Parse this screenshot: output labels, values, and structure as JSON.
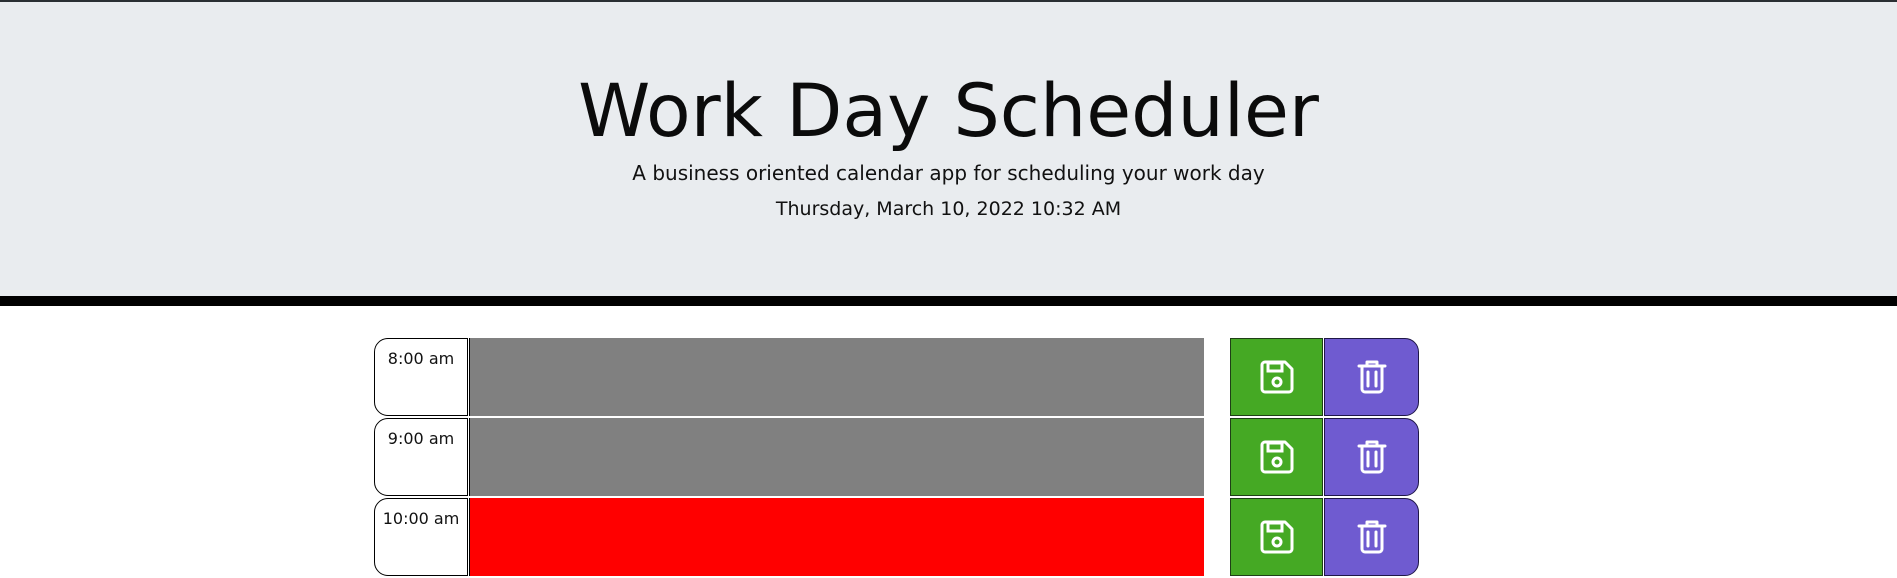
{
  "header": {
    "title": "Work Day Scheduler",
    "subtitle": "A business oriented calendar app for scheduling your work day",
    "current_date": "Thursday, March 10, 2022 10:32 AM"
  },
  "colors": {
    "past": "#808080",
    "present": "#ff0000",
    "future": "#77dd77",
    "save": "#45a924",
    "delete": "#6f5bd0",
    "header_bg": "#e9ecef"
  },
  "timeblocks": [
    {
      "hour": "8:00 am",
      "status": "past",
      "text": "",
      "save_icon": "floppy-disk-icon",
      "delete_icon": "trash-icon"
    },
    {
      "hour": "9:00 am",
      "status": "past",
      "text": "",
      "save_icon": "floppy-disk-icon",
      "delete_icon": "trash-icon"
    },
    {
      "hour": "10:00 am",
      "status": "present",
      "text": "",
      "save_icon": "floppy-disk-icon",
      "delete_icon": "trash-icon"
    }
  ]
}
